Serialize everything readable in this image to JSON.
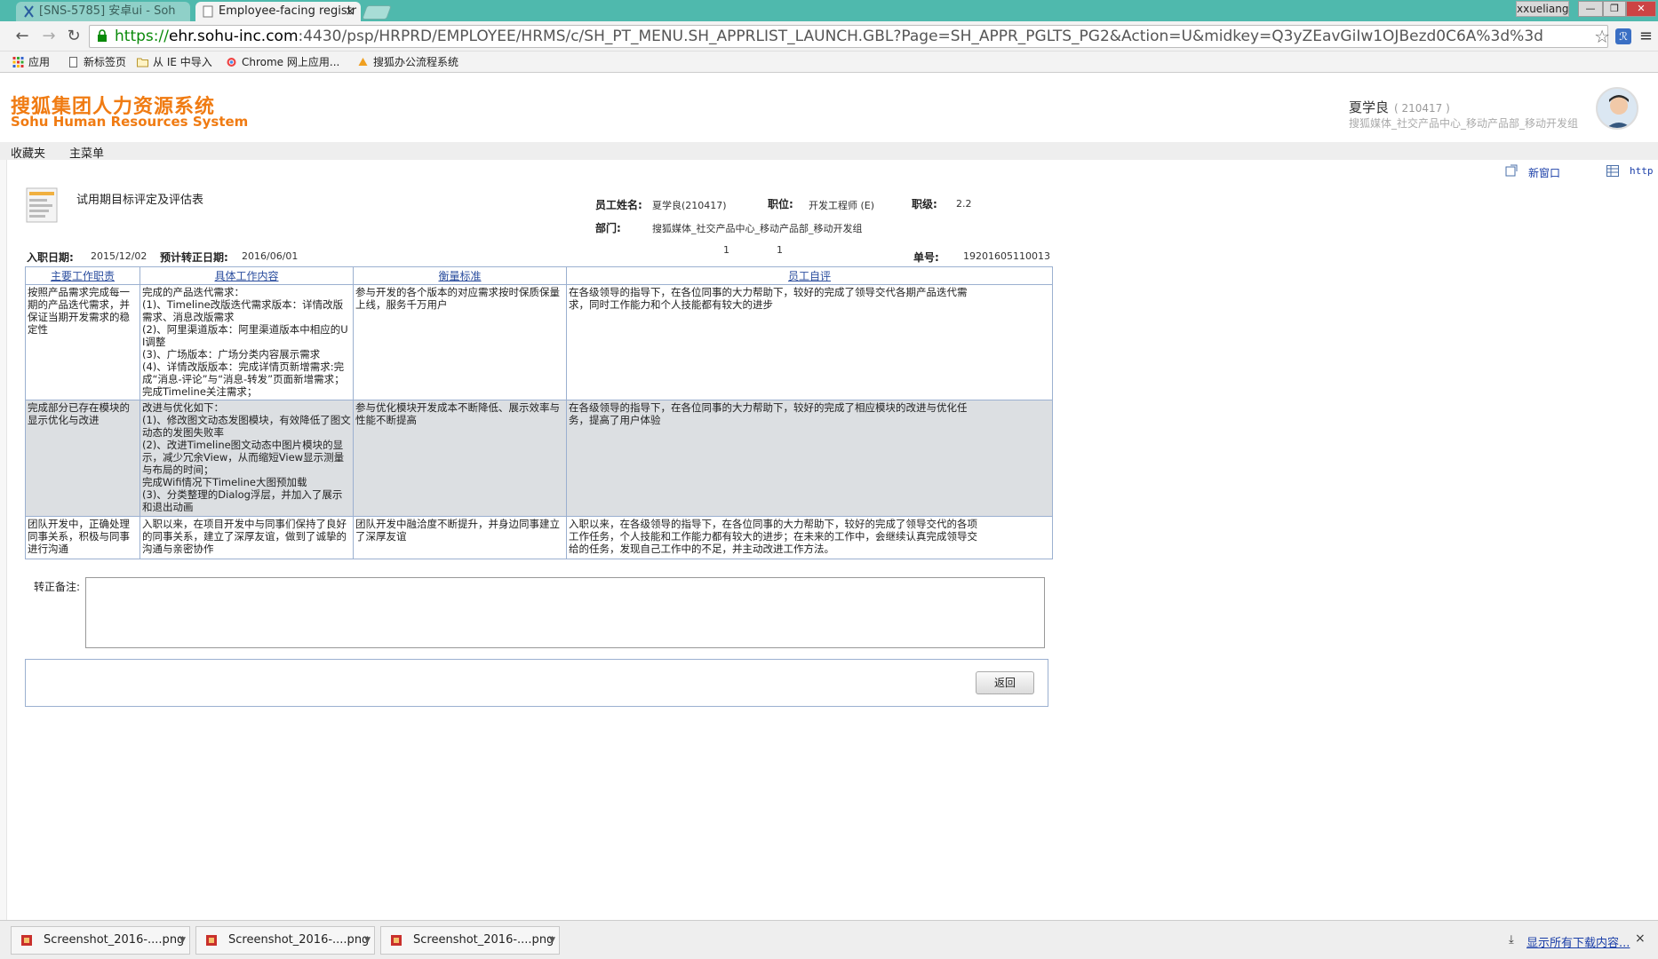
{
  "browser": {
    "tabs": [
      {
        "label": "[SNS-5785] 安卓ui - Soh"
      },
      {
        "label": "Employee-facing registr",
        "close": "×"
      }
    ],
    "user_chip": "xxueliang",
    "url": {
      "scheme": "https://",
      "host": "ehr.sohu-inc.com",
      "rest": ":4430/psp/HRPRD/EMPLOYEE/HRMS/c/SH_PT_MENU.SH_APPRLIST_LAUNCH.GBL?Page=SH_APPR_PGLTS_PG2&Action=U&midkey=Q3yZEavGiIw1OJBezd0C6A%3d%3d"
    },
    "bookmarks": [
      {
        "label": "应用",
        "icon": "apps-grid-icon"
      },
      {
        "label": "新标签页",
        "icon": "page-icon"
      },
      {
        "label": "从 IE 中导入",
        "icon": "folder-icon"
      },
      {
        "label": "Chrome 网上应用...",
        "icon": "chrome-store-icon"
      },
      {
        "label": "搜狐办公流程系统",
        "icon": "sohu-icon"
      }
    ]
  },
  "app": {
    "logo_cn": "搜狐集团人力资源系统",
    "logo_en": "Sohu Human Resources System",
    "user_name": "夏学良",
    "user_id": "( 210417 )",
    "user_dept": "搜狐媒体_社交产品中心_移动产品部_移动开发组",
    "nav": [
      "收藏夹",
      "主菜单"
    ],
    "new_window": "新窗口",
    "http_link": "http"
  },
  "form": {
    "title": "试用期目标评定及评估表",
    "fields": {
      "employee_name_label": "员工姓名:",
      "employee_name": "夏学良(210417)",
      "position_label": "职位:",
      "position": "开发工程师 (E)",
      "grade_label": "职级:",
      "grade": "2.2",
      "dept_label": "部门:",
      "dept": "搜狐媒体_社交产品中心_移动产品部_移动开发组",
      "hire_date_label": "入职日期:",
      "hire_date": "2015/12/02",
      "expected_date_label": "预计转正日期:",
      "expected_date": "2016/06/01",
      "count_a": "1",
      "count_b": "1",
      "order_label": "单号:",
      "order_no": "19201605110013"
    },
    "table": {
      "headers": [
        "主要工作职责",
        "具体工作内容",
        "衡量标准",
        "员工自评"
      ],
      "rows": [
        [
          "按照产品需求完成每一期的产品迭代需求，并保证当期开发需求的稳定性",
          "完成的产品迭代需求：\n(1)、Timeline改版迭代需求版本：详情改版需求、消息改版需求\n(2)、阿里渠道版本：阿里渠道版本中相应的UI调整\n(3)、广场版本：广场分类内容展示需求\n(4)、详情改版版本：完成详情页新增需求:完成“消息-评论”与“消息-转发”页面新增需求；完成Timeline关注需求；",
          "参与开发的各个版本的对应需求按时保质保量上线，服务千万用户",
          "在各级领导的指导下，在各位同事的大力帮助下，较好的完成了领导交代各期产品迭代需求，同时工作能力和个人技能都有较大的进步"
        ],
        [
          "完成部分已存在模块的显示优化与改进",
          "改进与优化如下：\n(1)、修改图文动态发图模块，有效降低了图文动态的发图失败率\n(2)、改进Timeline图文动态中图片模块的显示，减少冗余View，从而缩短View显示测量与布局的时间；\n完成Wifi情况下Timeline大图预加载\n(3)、分类整理的Dialog浮层，并加入了展示和退出动画",
          "参与优化模块开发成本不断降低、展示效率与性能不断提高",
          "在各级领导的指导下，在各位同事的大力帮助下，较好的完成了相应模块的改进与优化任务，提高了用户体验"
        ],
        [
          "团队开发中，正确处理同事关系，积极与同事进行沟通",
          "入职以来，在项目开发中与同事们保持了良好的同事关系，建立了深厚友谊，做到了诚挚的沟通与亲密协作",
          "团队开发中融洽度不断提升，并身边同事建立了深厚友谊",
          "入职以来，在各级领导的指导下，在各位同事的大力帮助下，较好的完成了领导交代的各项工作任务，个人技能和工作能力都有较大的进步；在未来的工作中，会继续认真完成领导交给的任务，发现自己工作中的不足，并主动改进工作方法。"
        ]
      ]
    },
    "remark_label": "转正备注:",
    "remark_value": "",
    "return_button": "返回"
  },
  "downloads": {
    "items": [
      "Screenshot_2016-....png",
      "Screenshot_2016-....png",
      "Screenshot_2016-....png"
    ],
    "show_all": "显示所有下载内容...",
    "close": "×"
  }
}
